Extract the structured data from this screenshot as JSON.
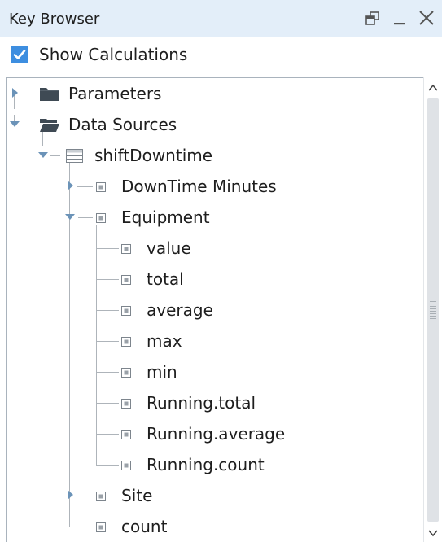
{
  "window": {
    "title": "Key Browser",
    "controls": {
      "restore_icon": "restore-icon",
      "minimize_icon": "minimize-icon",
      "close_icon": "close-icon"
    }
  },
  "options": {
    "show_calculations": {
      "label": "Show Calculations",
      "checked": true
    }
  },
  "tree": {
    "nodes": [
      {
        "label": "Parameters",
        "icon": "folder-icon",
        "expanded": false
      },
      {
        "label": "Data Sources",
        "icon": "folder-open-icon",
        "expanded": true
      },
      {
        "label": "shiftDowntime",
        "icon": "table-icon",
        "expanded": true
      },
      {
        "label": "DownTime Minutes",
        "icon": "key-icon",
        "expanded": false
      },
      {
        "label": "Equipment",
        "icon": "key-icon",
        "expanded": true
      },
      {
        "label": "value",
        "icon": "key-icon"
      },
      {
        "label": "total",
        "icon": "key-icon"
      },
      {
        "label": "average",
        "icon": "key-icon"
      },
      {
        "label": "max",
        "icon": "key-icon"
      },
      {
        "label": "min",
        "icon": "key-icon"
      },
      {
        "label": "Running.total",
        "icon": "key-icon"
      },
      {
        "label": "Running.average",
        "icon": "key-icon"
      },
      {
        "label": "Running.count",
        "icon": "key-icon"
      },
      {
        "label": "Site",
        "icon": "key-icon",
        "expanded": false
      },
      {
        "label": "count",
        "icon": "key-icon"
      }
    ]
  },
  "colors": {
    "title_bar": "#e3eef9",
    "checkbox": "#3d8ee0",
    "folder": "#3f4a54",
    "expander": "#6b93b8",
    "connector": "#aeb4ba",
    "scroll_thumb": "#dfe2e6"
  }
}
